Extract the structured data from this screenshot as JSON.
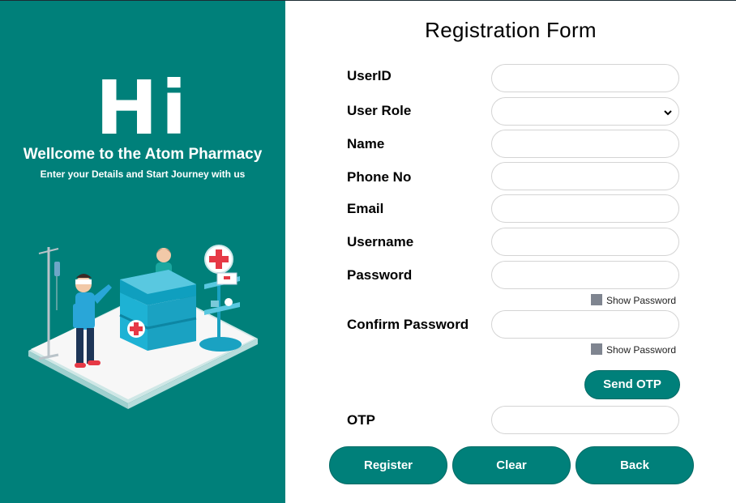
{
  "welcome_panel": {
    "hi": "Hi",
    "headline": "Wellcome to the Atom Pharmacy",
    "tagline": "Enter your Details and Start Journey with us"
  },
  "form": {
    "title": "Registration Form",
    "userid_label": "UserID",
    "userid_value": "",
    "role_label": "User Role",
    "role_value": "",
    "name_label": "Name",
    "name_value": "",
    "phone_label": "Phone No",
    "phone_value": "",
    "email_label": "Email",
    "email_value": "",
    "username_label": "Username",
    "username_value": "",
    "password_label": "Password",
    "password_value": "",
    "show_password_label": "Show Password",
    "confirm_label": "Confirm Password",
    "confirm_value": "",
    "confirm_show_label": "Show Password",
    "send_otp_label": "Send OTP",
    "otp_label": "OTP",
    "otp_value": ""
  },
  "actions": {
    "register": "Register",
    "clear": "Clear",
    "back": "Back"
  },
  "colors": {
    "brand": "#00807a",
    "checkbox": "#7f8590"
  }
}
